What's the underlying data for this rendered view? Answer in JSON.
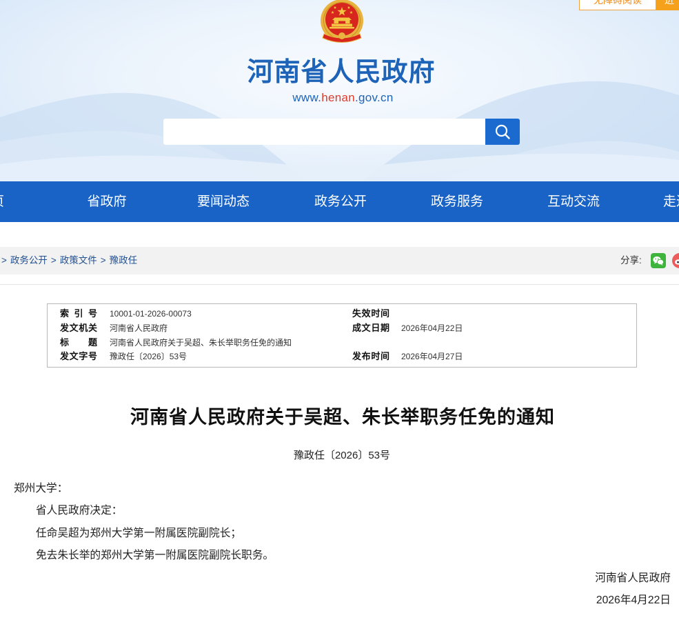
{
  "header": {
    "accessibility_label": "无障碍阅读",
    "care_label": "进",
    "site_title": "河南省人民政府",
    "url": {
      "prefix": "www.",
      "highlight": "henan",
      "suffix": ".gov.cn"
    },
    "colors": {
      "title": "#1d63b7",
      "url_highlight": "#e23a2a",
      "accent_orange": "#f39a1e"
    }
  },
  "search": {
    "button_icon": "search-icon",
    "button_color": "#1a6ad0"
  },
  "nav": {
    "background": "#1a63c6",
    "items": [
      "页",
      "省政府",
      "要闻动态",
      "政务公开",
      "政务服务",
      "互动交流",
      "走进"
    ]
  },
  "breadcrumb": {
    "separator": ">",
    "items": [
      "政务公开",
      "政策文件",
      "豫政任"
    ]
  },
  "share": {
    "label": "分享:",
    "icons": [
      "wechat-icon",
      "weibo-icon"
    ]
  },
  "info": {
    "rows": [
      {
        "label": "索 引 号",
        "value": "10001-01-2026-00073",
        "label2": "失效时间"
      },
      {
        "label": "发文机关",
        "value": "河南省人民政府",
        "label2": "成文日期",
        "value2": "2026年04月22日"
      },
      {
        "label": "标　　题",
        "value": "河南省人民政府关于吴超、朱长举职务任免的通知"
      },
      {
        "label": "发文字号",
        "value": "豫政任〔2026〕53号",
        "label2": "发布时间",
        "value2": "2026年04月27日"
      }
    ]
  },
  "document": {
    "title": "河南省人民政府关于吴超、朱长举职务任免的通知",
    "number": "豫政任〔2026〕53号",
    "salutation": "郑州大学：",
    "paragraphs": [
      "省人民政府决定：",
      "任命吴超为郑州大学第一附属医院副院长；",
      "免去朱长举的郑州大学第一附属医院副院长职务。"
    ],
    "signature": "河南省人民政府",
    "date": "2026年4月22日"
  }
}
